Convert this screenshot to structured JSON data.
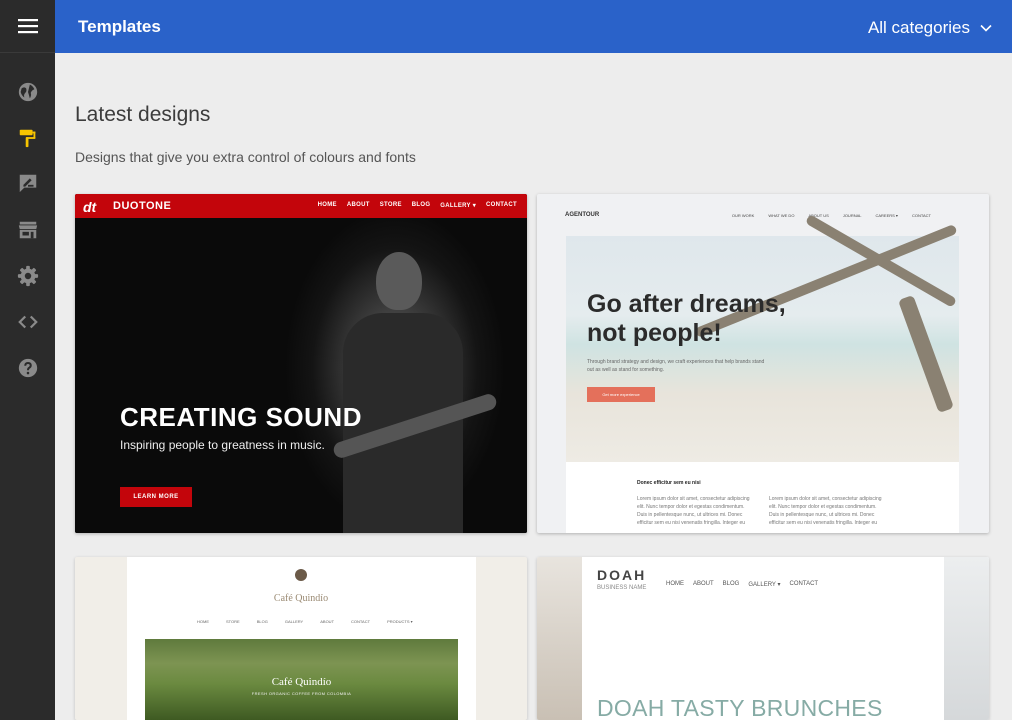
{
  "header": {
    "title": "Templates",
    "category_select": "All categories"
  },
  "sidebar": {
    "items": [
      {
        "icon": "globe-icon"
      },
      {
        "icon": "paint-roller-icon",
        "active": true
      },
      {
        "icon": "edit-icon"
      },
      {
        "icon": "store-icon"
      },
      {
        "icon": "gear-icon"
      },
      {
        "icon": "code-icon"
      },
      {
        "icon": "help-icon"
      }
    ]
  },
  "main": {
    "section_title": "Latest designs",
    "section_subtitle": "Designs that give you extra control of colours and fonts"
  },
  "templates": {
    "duotone": {
      "logo": "dt",
      "brand": "DUOTONE",
      "nav": [
        "HOME",
        "ABOUT",
        "STORE",
        "BLOG",
        "GALLERY ▾",
        "CONTACT"
      ],
      "headline": "CREATING SOUND",
      "tagline": "Inspiring people to greatness in music.",
      "button": "LEARN MORE"
    },
    "agentour": {
      "brand": "AGENTOUR",
      "nav": [
        "OUR WORK",
        "WHAT WE DO",
        "ABOUT US",
        "JOURNAL",
        "CAREERS ▾",
        "CONTACT"
      ],
      "headline_line1": "Go after dreams,",
      "headline_line2": "not people!",
      "body": "Through brand strategy and design, we craft experiences that help brands stand out as well as stand for something.",
      "button": "Get more experience",
      "subheading": "Donec efficitur sem eu nisi",
      "col1": "Lorem ipsum dolor sit amet, consectetur adipiscing elit. Nunc tempor dolor et egestas condimentum. Duis in pellentesque nunc, ut ultrices mi. Donec efficitur sem eu nisi venenatis fringilla. Integer eu",
      "col2": "Lorem ipsum dolor sit amet, consectetur adipiscing elit. Nunc tempor dolor et egestas condimentum. Duis in pellentesque nunc, ut ultrices mi. Donec efficitur sem eu nisi venenatis fringilla. Integer eu"
    },
    "cafe": {
      "title": "Café Quindío",
      "nav": [
        "HOME",
        "STORE",
        "BLOG",
        "GALLERY",
        "ABOUT",
        "CONTACT",
        "PRODUCTS ▾"
      ],
      "photo_title": "Café Quindío",
      "photo_subtitle": "FRESH ORGANIC COFFEE FROM COLOMBIA"
    },
    "doah": {
      "logo": "DOAH",
      "business_name": "BUSINESS NAME",
      "nav": [
        "HOME",
        "ABOUT",
        "BLOG",
        "GALLERY ▾",
        "CONTACT"
      ],
      "headline": "DOAH TASTY BRUNCHES"
    }
  },
  "colors": {
    "header": "#2a62c9",
    "sidebar": "#2b2b2b",
    "active_icon": "#f7c400",
    "duotone_red": "#c3050b",
    "agentour_button": "#e4705b"
  }
}
